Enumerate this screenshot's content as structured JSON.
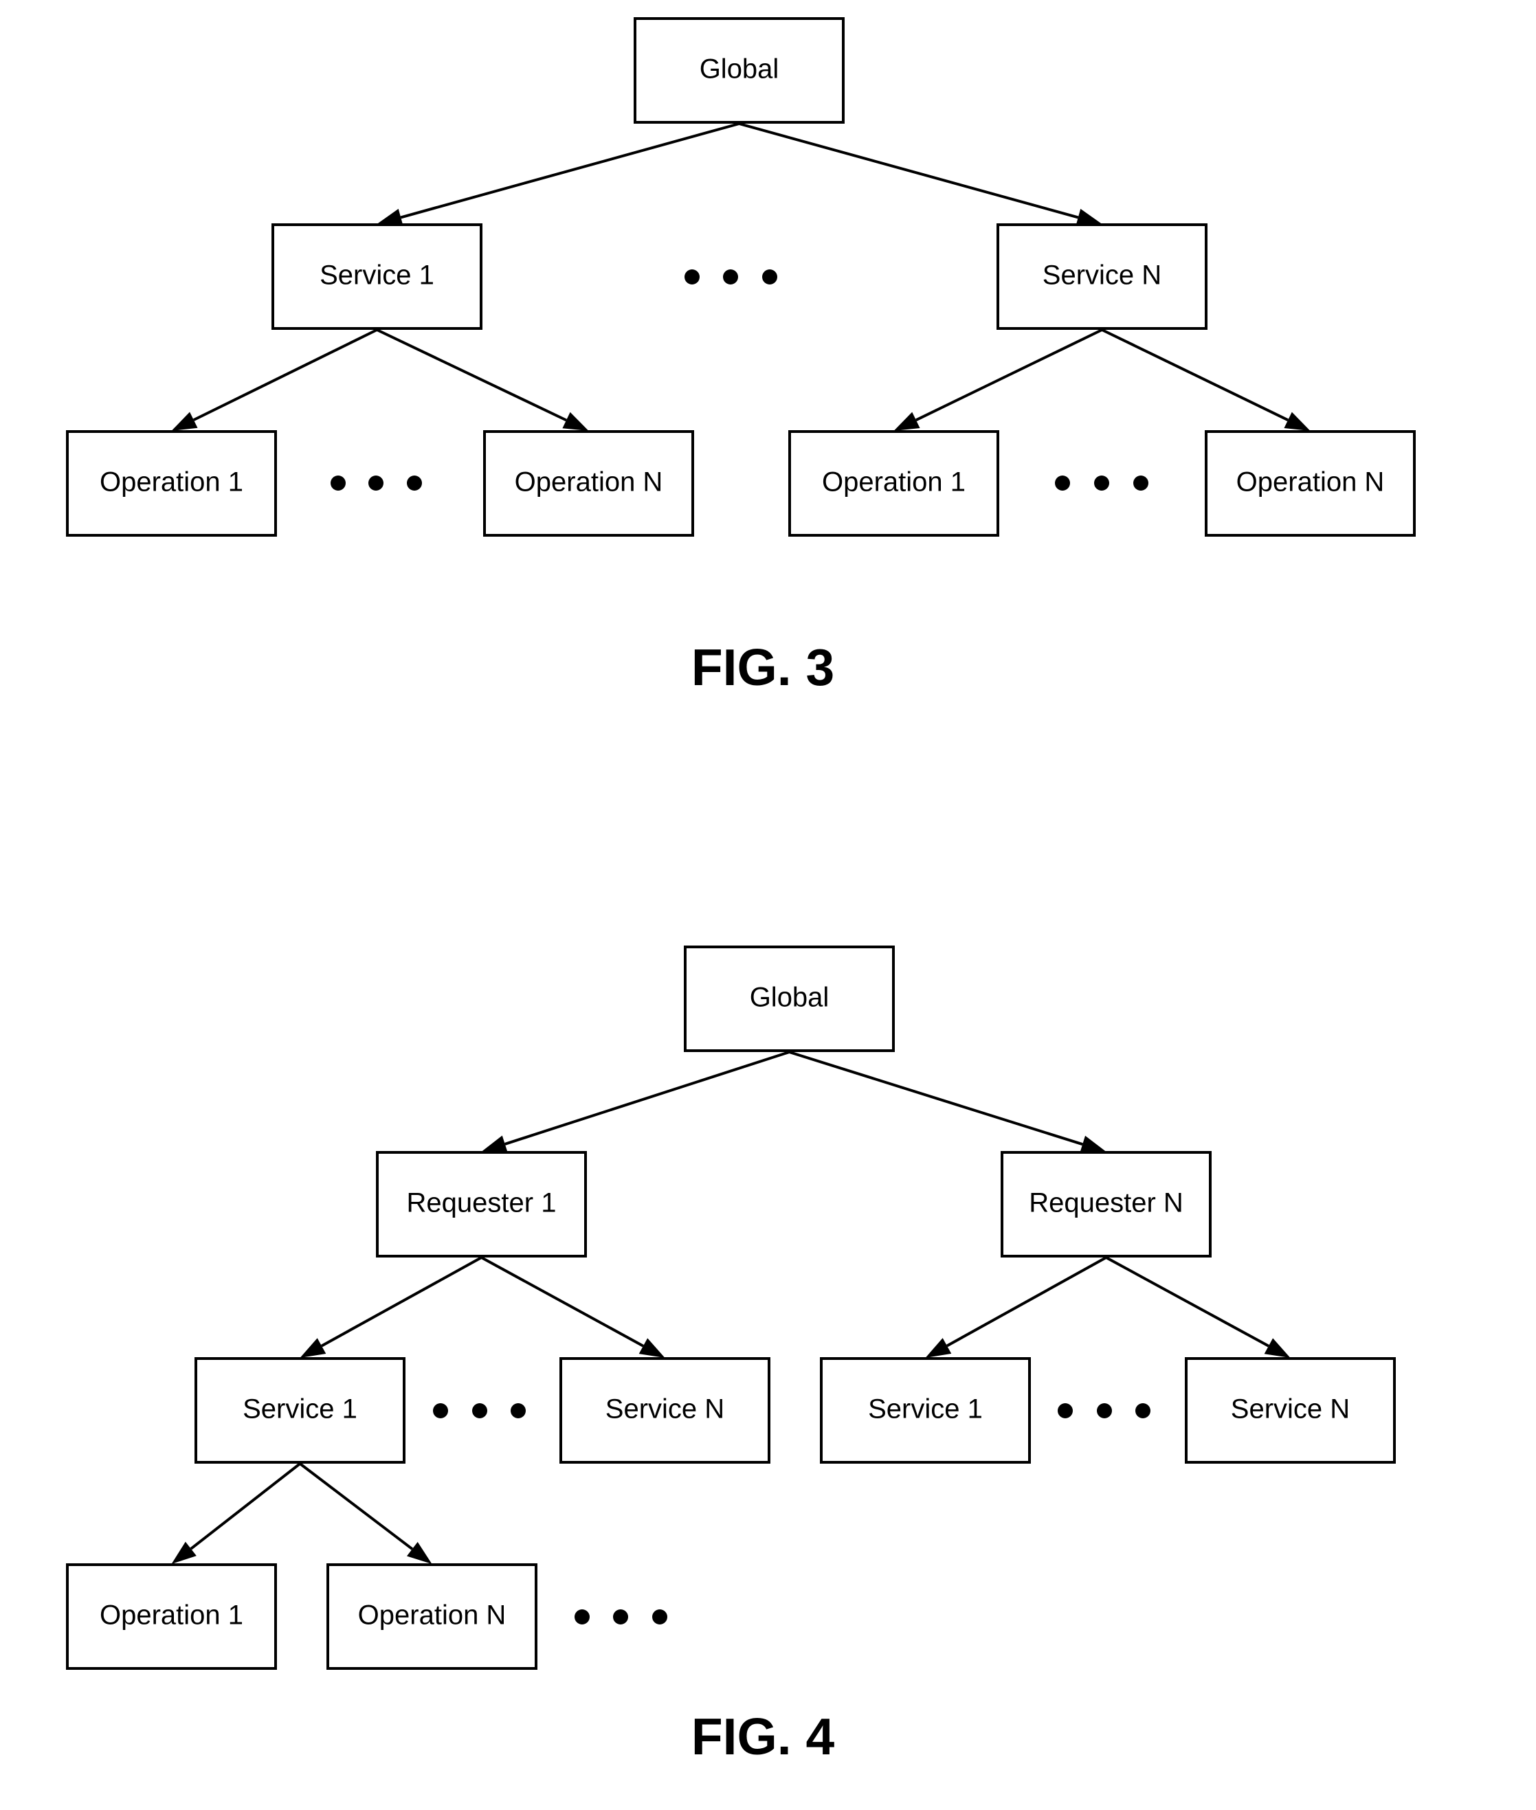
{
  "figures": [
    {
      "id": "fig3",
      "caption": "FIG. 3",
      "nodes": {
        "global": "Global",
        "service_1": "Service 1",
        "service_n": "Service N",
        "s1_operation_1": "Operation 1",
        "s1_operation_n": "Operation N",
        "sn_operation_1": "Operation 1",
        "sn_operation_n": "Operation N"
      },
      "edges": [
        [
          "global",
          "service_1"
        ],
        [
          "global",
          "service_n"
        ],
        [
          "service_1",
          "s1_operation_1"
        ],
        [
          "service_1",
          "s1_operation_n"
        ],
        [
          "service_n",
          "sn_operation_1"
        ],
        [
          "service_n",
          "sn_operation_n"
        ]
      ],
      "ellipses": [
        "between service_1 and service_n",
        "between s1_operation_1 and s1_operation_n",
        "between sn_operation_1 and sn_operation_n"
      ]
    },
    {
      "id": "fig4",
      "caption": "FIG. 4",
      "nodes": {
        "global": "Global",
        "requester_1": "Requester 1",
        "requester_n": "Requester N",
        "r1_service_1": "Service 1",
        "r1_service_n": "Service N",
        "rn_service_1": "Service 1",
        "rn_service_n": "Service N",
        "r1s1_operation_1": "Operation 1",
        "r1s1_operation_n": "Operation N"
      },
      "edges": [
        [
          "global",
          "requester_1"
        ],
        [
          "global",
          "requester_n"
        ],
        [
          "requester_1",
          "r1_service_1"
        ],
        [
          "requester_1",
          "r1_service_n"
        ],
        [
          "requester_n",
          "rn_service_1"
        ],
        [
          "requester_n",
          "rn_service_n"
        ],
        [
          "r1_service_1",
          "r1s1_operation_1"
        ],
        [
          "r1_service_1",
          "r1s1_operation_n"
        ]
      ],
      "ellipses": [
        "between r1_service_1 and r1_service_n",
        "between rn_service_1 and rn_service_n",
        "after r1s1_operation_n"
      ]
    }
  ]
}
